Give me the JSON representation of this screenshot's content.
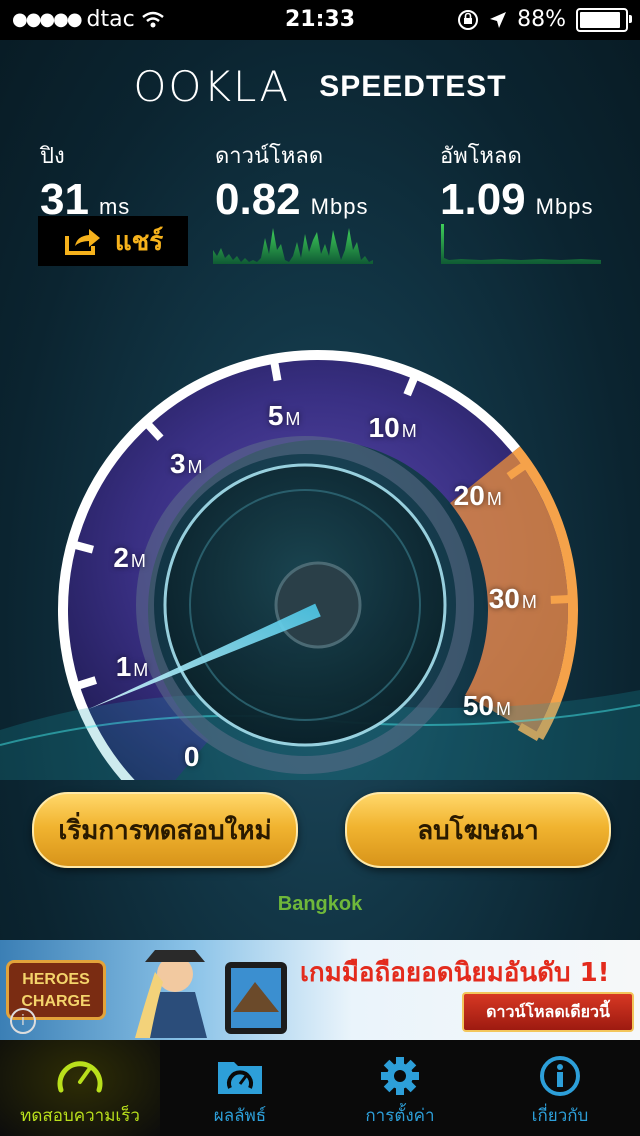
{
  "status_bar": {
    "carrier": "dtac",
    "time": "21:33",
    "battery": "88%"
  },
  "header": {
    "logo": "OOKLA",
    "title": "SPEEDTEST"
  },
  "metrics": {
    "ping": {
      "label": "ปิง",
      "value": "31",
      "unit": "ms"
    },
    "download": {
      "label": "ดาวน์โหลด",
      "value": "0.82",
      "unit": "Mbps"
    },
    "upload": {
      "label": "อัพโหลด",
      "value": "1.09",
      "unit": "Mbps"
    }
  },
  "share": {
    "label": "แชร์",
    "icon": "share-icon"
  },
  "gauge": {
    "ticks": [
      {
        "num": "0",
        "unit": ""
      },
      {
        "num": "1",
        "unit": "M"
      },
      {
        "num": "2",
        "unit": "M"
      },
      {
        "num": "3",
        "unit": "M"
      },
      {
        "num": "5",
        "unit": "M"
      },
      {
        "num": "10",
        "unit": "M"
      },
      {
        "num": "20",
        "unit": "M"
      },
      {
        "num": "30",
        "unit": "M"
      },
      {
        "num": "50",
        "unit": "M"
      }
    ],
    "needle_value": 0.82
  },
  "buttons": {
    "retest": "เริ่มการทดสอบใหม่",
    "remove_ads": "ลบโฆษณา"
  },
  "location": "Bangkok",
  "ad": {
    "logo_line1": "HEROES",
    "logo_line2": "CHARGE",
    "headline": "เกมมือถือยอดนิยมอันดับ 1!",
    "cta": "ดาวน์โหลดเดียวนี้"
  },
  "tabs": [
    {
      "label": "ทดสอบความเร็ว",
      "icon": "speedometer-icon",
      "active": true
    },
    {
      "label": "ผลลัพธ์",
      "icon": "folder-gauge-icon",
      "active": false
    },
    {
      "label": "การตั้งค่า",
      "icon": "gear-icon",
      "active": false
    },
    {
      "label": "เกี่ยวกับ",
      "icon": "info-icon",
      "active": false
    }
  ],
  "colors": {
    "accent": "#2d9fd9",
    "active_tab": "#b9e01c",
    "share": "#f6b21c",
    "location": "#6fb83a",
    "gauge_orange": "#f0923a"
  }
}
